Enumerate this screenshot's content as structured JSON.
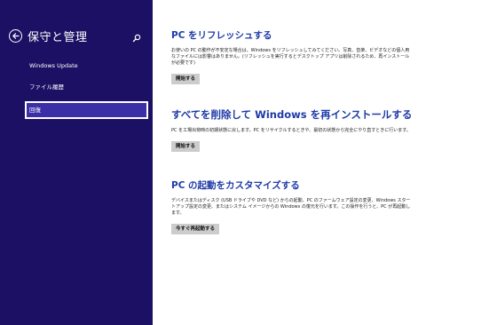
{
  "sidebar": {
    "title": "保守と管理",
    "items": [
      {
        "label": "Windows Update"
      },
      {
        "label": "ファイル履歴"
      },
      {
        "label": "回復"
      }
    ]
  },
  "sections": [
    {
      "title": "PC をリフレッシュする",
      "description": "お使いの PC の動作が不安定な場合は、Windows をリフレッシュしてみてください。写真、音楽、ビデオなどの個人用なファイルには影響はありません。(リフレッシュを実行するとデスクトップ アプリは削除されるため、再インストールが必要です)",
      "button": "開始する"
    },
    {
      "title": "すべてを削除して Windows を再インストールする",
      "description": "PC を工場出荷時の初期状態に戻します。PC をリサイクルするときや、最初の状態から完全にやり直すときに行います。",
      "button": "開始する"
    },
    {
      "title": "PC の起動をカスタマイズする",
      "description": "デバイスまたはディスク (USB ドライブや DVD など) からの起動、PC のファームウェア設定の変更、Windows スタートアップ設定の変更、またはシステム イメージからの Windows の復元を行います。この操作を行うと、PC が再起動します。",
      "button": "今すぐ再起動する"
    }
  ],
  "colors": {
    "sidebar_bg": "#1c1064",
    "title_blue": "#1e3aa8",
    "button_bg": "#cccccc"
  }
}
